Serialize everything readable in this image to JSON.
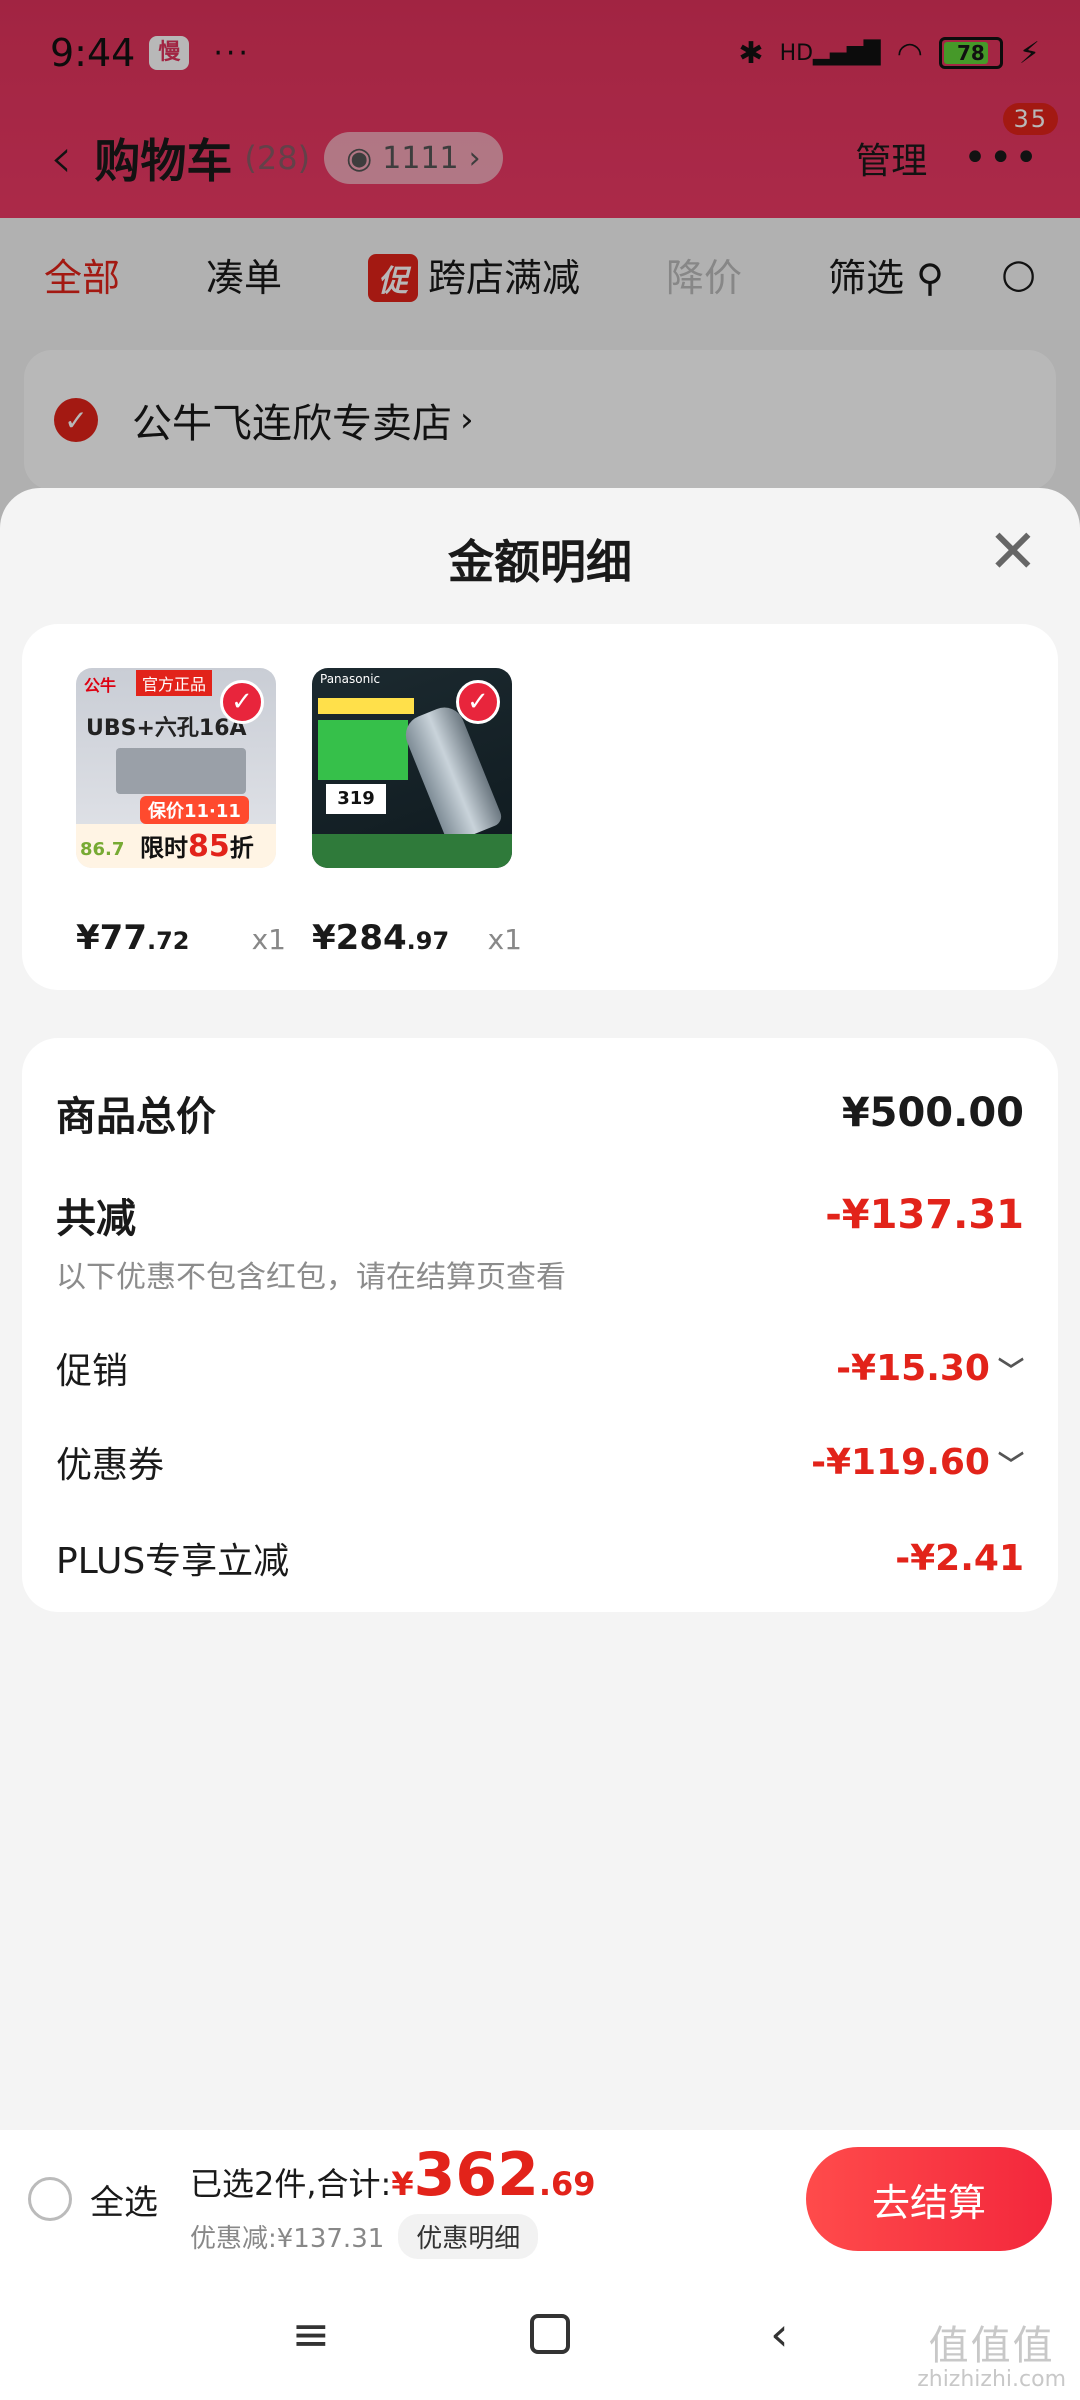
{
  "status_bar": {
    "time": "9:44",
    "app_badge": "慢",
    "dots": "···",
    "bluetooth": "✱",
    "signal": "HD▂▄▆█",
    "wifi": "◠",
    "battery": "78",
    "charging": "⚡"
  },
  "header": {
    "back": "‹",
    "title": "购物车",
    "count": "(28)",
    "visitors": "1111",
    "visitors_chevron": "›",
    "manage": "管理",
    "more": "•••",
    "more_badge": "35"
  },
  "filters": {
    "all": "全部",
    "bundle": "凑单",
    "promo_tag": "促",
    "cross_store": "跨店满减",
    "price_drop": "降价",
    "filter": "筛选",
    "filter_icon": "⚲",
    "search_icon": "○"
  },
  "store": {
    "name": "公牛飞连欣专卖店",
    "chevron": "›"
  },
  "sheet": {
    "title": "金额明细",
    "close": "✕",
    "products": [
      {
        "price_int": "¥77",
        "price_dec": ".72",
        "qty": "x1",
        "brand": "公牛",
        "tag": "官方正品",
        "name": "UBS+六孔16A",
        "sale": "保价11·11",
        "strip_left": "86.7",
        "strip_text": "限时",
        "strip_discount": "85",
        "strip_unit": "折"
      },
      {
        "price_int": "¥284",
        "price_dec": ".97",
        "qty": "x1",
        "brand": "Panasonic",
        "badge_price": "319"
      }
    ],
    "rows": {
      "total_label": "商品总价",
      "total_value": "¥500.00",
      "reduce_label": "共减",
      "reduce_value": "-¥137.31",
      "note": "以下优惠不包含红包，请在结算页查看",
      "promo_label": "促销",
      "promo_value": "-¥15.30",
      "coupon_label": "优惠券",
      "coupon_value": "-¥119.60",
      "plus_label": "PLUS专享立减",
      "plus_value": "-¥2.41",
      "chevron": "﹀"
    }
  },
  "checkout": {
    "select_all": "全选",
    "selected_text": "已选2件,合计:",
    "yen": "¥",
    "amount_int": "362",
    "amount_dec": ".69",
    "discount_text": "优惠减:¥137.31",
    "detail_button": "优惠明细",
    "checkout_button": "去结算"
  },
  "sysnav": {
    "menu": "≡",
    "back": "‹"
  },
  "watermark": {
    "big": "值值值",
    "small": "zhizhizhi.com"
  },
  "colors": {
    "accent": "#e2231a",
    "header": "#e0335c",
    "sheet_bg": "#f4f4f4"
  }
}
